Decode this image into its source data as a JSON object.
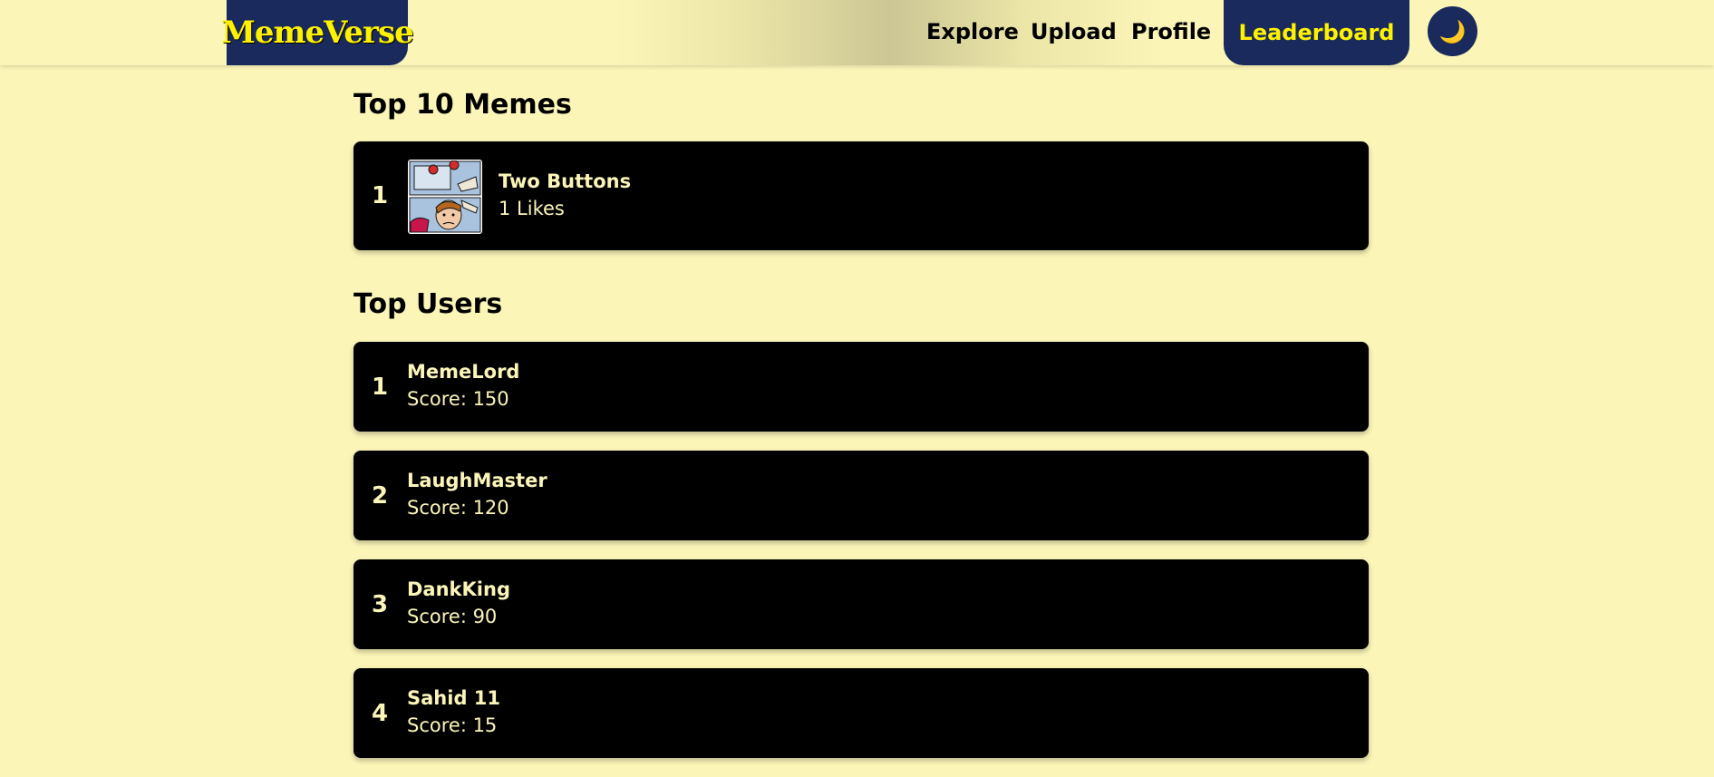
{
  "app": {
    "logo": "MemeVerse"
  },
  "nav": {
    "explore": "Explore",
    "upload": "Upload",
    "profile": "Profile",
    "leaderboard": "Leaderboard",
    "theme_icon": "moon-icon",
    "theme_glyph": "🌙"
  },
  "top_memes": {
    "title": "Top 10 Memes",
    "items": [
      {
        "rank": "1",
        "name": "Two Buttons",
        "likes": "1 Likes"
      }
    ]
  },
  "top_users": {
    "title": "Top Users",
    "items": [
      {
        "rank": "1",
        "name": "MemeLord",
        "score": "Score: 150"
      },
      {
        "rank": "2",
        "name": "LaughMaster",
        "score": "Score: 120"
      },
      {
        "rank": "3",
        "name": "DankKing",
        "score": "Score: 90"
      },
      {
        "rank": "4",
        "name": "Sahid 11",
        "score": "Score: 15"
      }
    ]
  },
  "colors": {
    "background": "#fbf5b8",
    "navy": "#1a2a5c",
    "logo_text": "#fff200",
    "card": "#000000",
    "card_text": "#fbf5b8"
  }
}
